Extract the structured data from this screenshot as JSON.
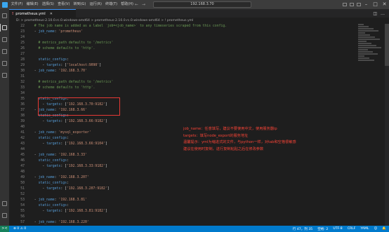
{
  "titlebar": {
    "menu": [
      "文件(F)",
      "编辑(E)",
      "选择(S)",
      "查看(V)",
      "转到(G)",
      "运行(R)",
      "终端(T)",
      "帮助(H)"
    ],
    "search": "192.168.3.70",
    "nav_back": "←",
    "nav_forward": "→",
    "minimize": "–",
    "maximize": "□",
    "close": "✕"
  },
  "tab": {
    "icon": "!",
    "label": "prometheus.yml",
    "close": "✕"
  },
  "breadcrumb": "D: > prometheus-2.10.0.rc.0.windows-amd64 > prometheus-2.10.0.rc.0.windows-amd64 > ! prometheus.yml",
  "editor": {
    "line_numbers": [
      "22",
      "23",
      "24",
      "25",
      "26",
      "27",
      "28",
      "29",
      "30",
      "31",
      "32",
      "33",
      "34",
      "35",
      "36",
      "37",
      "38",
      "39",
      "40",
      "41",
      "42",
      "43",
      "44",
      "45",
      "46",
      "47",
      "48",
      "49",
      "50",
      "51",
      "52",
      "53",
      "54",
      "55",
      "56",
      "57"
    ],
    "lines": [
      [
        {
          "c": "cm",
          "t": "  # The job name is added as a label `job=<job_name>` to any timeseries scraped from this config."
        }
      ],
      [
        {
          "c": "pn",
          "t": "  - "
        },
        {
          "c": "ky",
          "t": "job_name"
        },
        {
          "c": "pn",
          "t": ": "
        },
        {
          "c": "st",
          "t": "'prometheus'"
        }
      ],
      [
        {
          "c": "pn",
          "t": ""
        }
      ],
      [
        {
          "c": "cm",
          "t": "    # metrics_path defaults to '/metrics'"
        }
      ],
      [
        {
          "c": "cm",
          "t": "    # scheme defaults to 'http'."
        }
      ],
      [
        {
          "c": "pn",
          "t": ""
        }
      ],
      [
        {
          "c": "pn",
          "t": "    "
        },
        {
          "c": "ky",
          "t": "static_configs"
        },
        {
          "c": "pn",
          "t": ":"
        }
      ],
      [
        {
          "c": "pn",
          "t": "      - "
        },
        {
          "c": "ky",
          "t": "targets"
        },
        {
          "c": "pn",
          "t": ": ["
        },
        {
          "c": "st",
          "t": "'localhost:9090'"
        },
        {
          "c": "pn",
          "t": "]"
        }
      ],
      [
        {
          "c": "pn",
          "t": "  - "
        },
        {
          "c": "ky",
          "t": "job_name"
        },
        {
          "c": "pn",
          "t": ": "
        },
        {
          "c": "st",
          "t": "'192.168.3.70'"
        }
      ],
      [
        {
          "c": "pn",
          "t": ""
        }
      ],
      [
        {
          "c": "cm",
          "t": "    # metrics_path defaults to '/metrics'"
        }
      ],
      [
        {
          "c": "cm",
          "t": "    # scheme defaults to 'http'."
        }
      ],
      [
        {
          "c": "pn",
          "t": ""
        }
      ],
      [
        {
          "c": "pn",
          "t": "    "
        },
        {
          "c": "ky",
          "t": "static_configs"
        },
        {
          "c": "pn",
          "t": ":"
        }
      ],
      [
        {
          "c": "pn",
          "t": "      - "
        },
        {
          "c": "ky",
          "t": "targets"
        },
        {
          "c": "pn",
          "t": ": ["
        },
        {
          "c": "st",
          "t": "'192.168.3.70:9182'"
        },
        {
          "c": "pn",
          "t": "]"
        }
      ],
      [
        {
          "c": "pn",
          "t": "  - "
        },
        {
          "c": "ky",
          "t": "job_name"
        },
        {
          "c": "pn",
          "t": ": "
        },
        {
          "c": "st",
          "t": "'192.168.3.66'"
        }
      ],
      [
        {
          "c": "pn",
          "t": "    "
        },
        {
          "c": "ky",
          "t": "static_configs"
        },
        {
          "c": "pn",
          "t": ":"
        }
      ],
      [
        {
          "c": "pn",
          "t": "      - "
        },
        {
          "c": "ky",
          "t": "targets"
        },
        {
          "c": "pn",
          "t": ": ["
        },
        {
          "c": "st",
          "t": "'192.168.3.66:9182'"
        },
        {
          "c": "pn",
          "t": "]"
        }
      ],
      [
        {
          "c": "pn",
          "t": ""
        }
      ],
      [
        {
          "c": "pn",
          "t": "  - "
        },
        {
          "c": "ky",
          "t": "job_name"
        },
        {
          "c": "pn",
          "t": ": "
        },
        {
          "c": "st",
          "t": "'mysql_exporter'"
        }
      ],
      [
        {
          "c": "pn",
          "t": "    "
        },
        {
          "c": "ky",
          "t": "static_configs"
        },
        {
          "c": "pn",
          "t": ":"
        }
      ],
      [
        {
          "c": "pn",
          "t": "      - "
        },
        {
          "c": "ky",
          "t": "targets"
        },
        {
          "c": "pn",
          "t": ": ["
        },
        {
          "c": "st",
          "t": "'192.168.3.66:9104'"
        },
        {
          "c": "pn",
          "t": "]"
        }
      ],
      [
        {
          "c": "pn",
          "t": ""
        }
      ],
      [
        {
          "c": "pn",
          "t": "  - "
        },
        {
          "c": "ky",
          "t": "job_name"
        },
        {
          "c": "pn",
          "t": ": "
        },
        {
          "c": "st",
          "t": "'192.168.3.33'"
        }
      ],
      [
        {
          "c": "pn",
          "t": "    "
        },
        {
          "c": "ky",
          "t": "static_configs"
        },
        {
          "c": "pn",
          "t": ":"
        }
      ],
      [
        {
          "c": "pn",
          "t": "      - "
        },
        {
          "c": "ky",
          "t": "targets"
        },
        {
          "c": "pn",
          "t": ": ["
        },
        {
          "c": "st",
          "t": "'192.168.3.33:9182'"
        },
        {
          "c": "pn",
          "t": "]"
        }
      ],
      [
        {
          "c": "pn",
          "t": ""
        }
      ],
      [
        {
          "c": "pn",
          "t": "  - "
        },
        {
          "c": "ky",
          "t": "job_name"
        },
        {
          "c": "pn",
          "t": ": "
        },
        {
          "c": "st",
          "t": "'192.168.3.207'"
        }
      ],
      [
        {
          "c": "pn",
          "t": "    "
        },
        {
          "c": "ky",
          "t": "static_configs"
        },
        {
          "c": "pn",
          "t": ":"
        }
      ],
      [
        {
          "c": "pn",
          "t": "      - "
        },
        {
          "c": "ky",
          "t": "targets"
        },
        {
          "c": "pn",
          "t": ": ["
        },
        {
          "c": "st",
          "t": "'192.168.3.207:9182'"
        },
        {
          "c": "pn",
          "t": "]"
        }
      ],
      [
        {
          "c": "pn",
          "t": ""
        }
      ],
      [
        {
          "c": "pn",
          "t": "  - "
        },
        {
          "c": "ky",
          "t": "job_name"
        },
        {
          "c": "pn",
          "t": ": "
        },
        {
          "c": "st",
          "t": "'192.168.3.81'"
        }
      ],
      [
        {
          "c": "pn",
          "t": "    "
        },
        {
          "c": "ky",
          "t": "static_configs"
        },
        {
          "c": "pn",
          "t": ":"
        }
      ],
      [
        {
          "c": "pn",
          "t": "      - "
        },
        {
          "c": "ky",
          "t": "targets"
        },
        {
          "c": "pn",
          "t": ": ["
        },
        {
          "c": "st",
          "t": "'192.168.3.81:9182'"
        },
        {
          "c": "pn",
          "t": "]"
        }
      ],
      [
        {
          "c": "pn",
          "t": ""
        }
      ],
      [
        {
          "c": "pn",
          "t": "  - "
        },
        {
          "c": "ky",
          "t": "job_name"
        },
        {
          "c": "pn",
          "t": ": "
        },
        {
          "c": "st",
          "t": "'192.168.3.220'"
        }
      ]
    ]
  },
  "annotation": [
    "job_name：任意填写，建议不要使用中文，使用服务器ip",
    "targets：填写node_export的服务地址",
    "温馨提示：yml为缩进式的文件，与python一样，对tab和空格很敏感",
    "建议在使用时复制，进行复制粘贴之后在修改参数"
  ],
  "status": {
    "remote": "><",
    "errors": "⊗ 0  ⚠ 0",
    "position": "行 47，列 35",
    "spaces": "空格: 2",
    "encoding": "UTF-8",
    "eol": "CRLF",
    "language": "YAML",
    "feedback": "☺",
    "bell": "🔔"
  }
}
